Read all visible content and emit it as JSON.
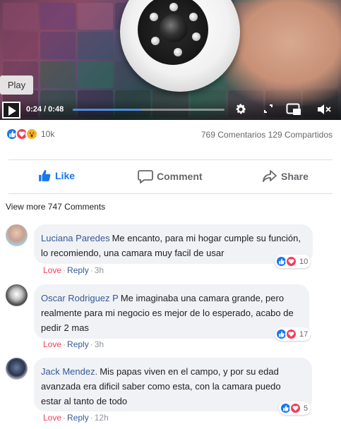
{
  "video": {
    "play_tooltip": "Play",
    "time": "0:24 / 0:48",
    "progress_fraction": 0.45,
    "icons": [
      "play-icon",
      "gear-icon",
      "expand-icon",
      "picture-in-picture-icon",
      "mute-icon"
    ]
  },
  "reactions": {
    "count": "10k",
    "comments": "769 Comentarios",
    "shares": "129 Compartidos",
    "colors": {
      "like": "#1877f2",
      "love": "#f33e58",
      "wow": "#f7b125"
    }
  },
  "actions": {
    "like": "Like",
    "comment": "Comment",
    "share": "Share"
  },
  "view_more": "View more 747 Comments",
  "comments": [
    {
      "name": "Luciana Paredes",
      "text": "Me encanto, para mi hogar cumple su función, lo recomiendo, una camara muy facil de usar",
      "love": "Love",
      "reply": "Reply",
      "time": "3h",
      "reactions": "10"
    },
    {
      "name": "Oscar Rodriguez P",
      "text": "Me imaginaba una camara grande, pero realmente para mi negocio es mejor de lo esperado, acabo de pedir 2 mas",
      "love": "Love",
      "reply": "Reply",
      "time": "3h",
      "reactions": "17"
    },
    {
      "name": "Jack Mendez.",
      "text": "Mis papas viven en el campo, y por su edad avanzada era dificil saber como esta, con la camara puedo estar al tanto de todo",
      "love": "Love",
      "reply": "Reply",
      "time": "12h",
      "reactions": "5"
    }
  ]
}
